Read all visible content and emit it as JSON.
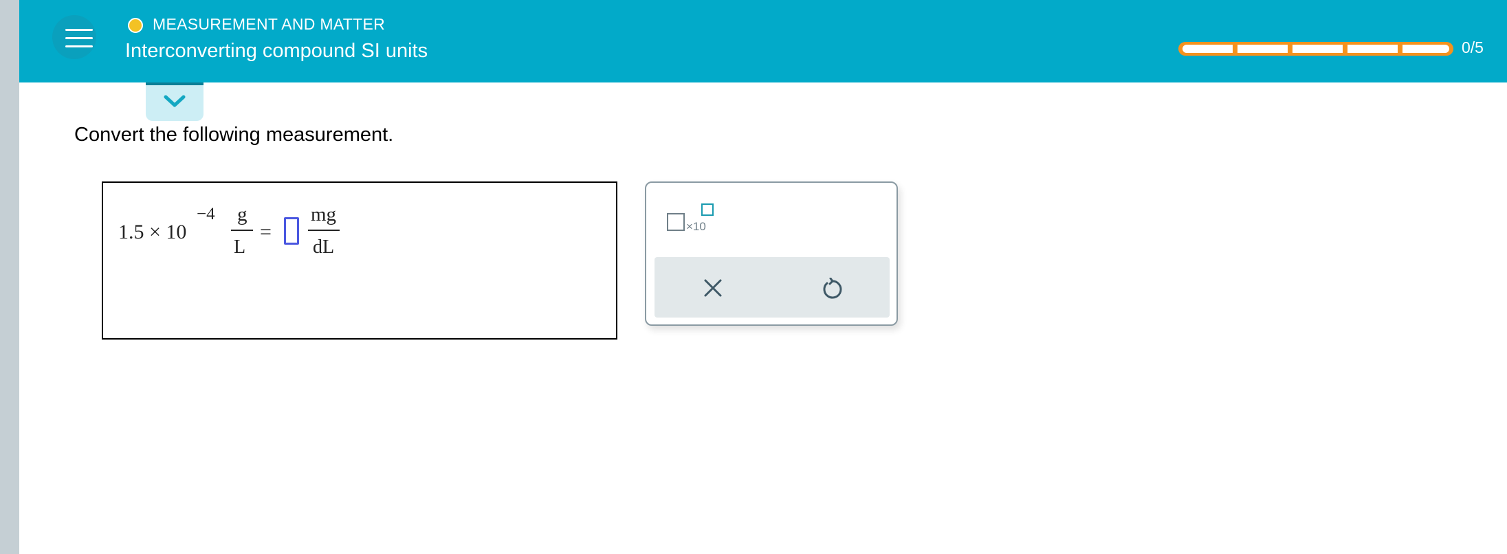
{
  "header": {
    "topic_label": "MEASUREMENT AND MATTER",
    "title": "Interconverting compound SI units",
    "progress_text": "0/5",
    "progress_value": 0,
    "progress_segments": 5,
    "menu_icon": "hamburger-menu-icon",
    "topic_status_color": "#f3c224",
    "brand_color": "#02aac9",
    "progress_color": "#f5921e"
  },
  "collapse": {
    "icon": "chevron-down-icon"
  },
  "question": {
    "prompt": "Convert the following measurement.",
    "coefficient": "1.5 × 10",
    "exponent": "−4",
    "from_unit_num": "g",
    "from_unit_den": "L",
    "equals": "=",
    "answer": "",
    "to_unit_num": "mg",
    "to_unit_den": "dL"
  },
  "tools": {
    "sci_notation_label": "×10",
    "sci_notation_icon": "scientific-notation-icon",
    "clear_icon": "x-icon",
    "undo_icon": "undo-icon"
  }
}
